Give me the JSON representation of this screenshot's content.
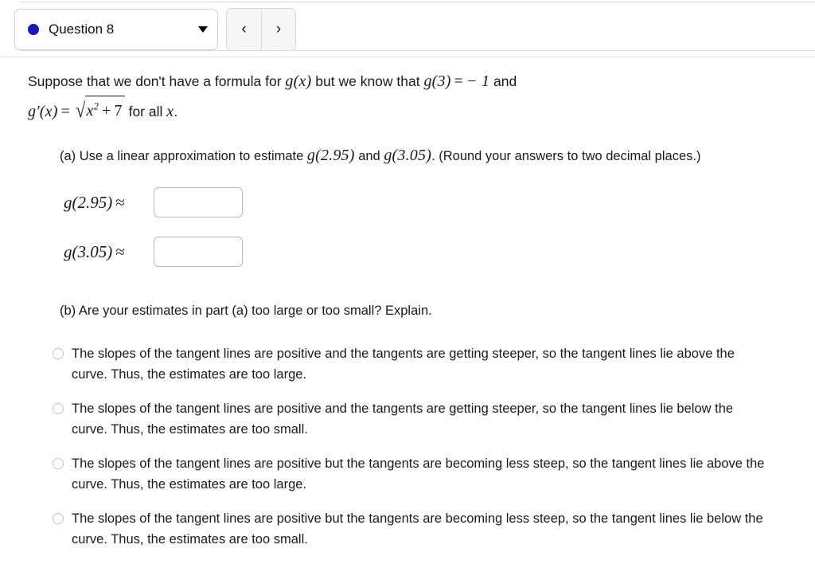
{
  "header": {
    "question_label": "Question 8",
    "status_dot_color": "#1a18b5",
    "dropdown_caret": "caret-down-icon",
    "prev_label": "‹",
    "next_label": "›"
  },
  "problem": {
    "intro_part1": "Suppose that we don't have a formula for ",
    "g_of_x": "g(x)",
    "intro_part2": " but we know that ",
    "g_of_3": "g(3)",
    "equals": "=",
    "value_neg1": "− 1",
    "intro_part3": " and",
    "derivative_lhs": "g′(x)",
    "derivative_equals": "=",
    "radical_symbol": "√",
    "radicand_base": "x",
    "radicand_exponent": "2",
    "radicand_plus": "+",
    "radicand_const": "7",
    "derivative_tail": " for all ",
    "derivative_var": "x",
    "derivative_period": "."
  },
  "part_a": {
    "text_lead": "(a) Use a linear approximation to estimate ",
    "target1": "g(2.95)",
    "text_and": " and ",
    "target2": "g(3.05)",
    "text_tail": ". (Round your answers to two decimal places.)",
    "answers": [
      {
        "label": "g(2.95)",
        "relation": "≈",
        "value": "",
        "placeholder": ""
      },
      {
        "label": "g(3.05)",
        "relation": "≈",
        "value": "",
        "placeholder": ""
      }
    ]
  },
  "part_b": {
    "prompt": "(b) Are your estimates in part (a) too large or too small? Explain.",
    "options": [
      {
        "id": "option-1",
        "selected": false,
        "text": "The slopes of the tangent lines are positive and the tangents are getting steeper, so the tangent lines lie above the curve. Thus, the estimates are too large."
      },
      {
        "id": "option-2",
        "selected": false,
        "text": "The slopes of the tangent lines are positive and the tangents are getting steeper, so the tangent lines lie below the curve. Thus, the estimates are too small."
      },
      {
        "id": "option-3",
        "selected": false,
        "text": "The slopes of the tangent lines are positive but the tangents are becoming less steep, so the tangent lines lie above the curve. Thus, the estimates are too large."
      },
      {
        "id": "option-4",
        "selected": false,
        "text": "The slopes of the tangent lines are positive but the tangents are becoming less steep, so the tangent lines lie below the curve. Thus, the estimates are too small."
      }
    ]
  }
}
